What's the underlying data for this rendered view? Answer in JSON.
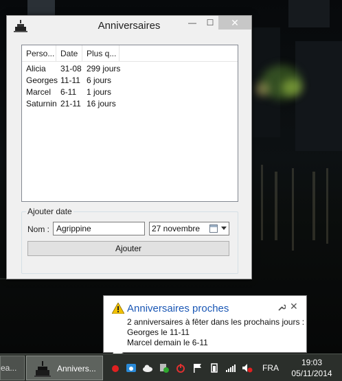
{
  "window": {
    "title": "Anniversaires",
    "controls": {
      "minimize": "—",
      "maximize": "☐",
      "close": "✕"
    }
  },
  "list": {
    "columns": [
      "Perso...",
      "Date",
      "Plus q..."
    ],
    "rows": [
      {
        "person": "Alicia",
        "date": "31-08",
        "remaining": "299 jours"
      },
      {
        "person": "Georges",
        "date": "11-11",
        "remaining": "6 jours"
      },
      {
        "person": "Marcel",
        "date": "6-11",
        "remaining": "1 jours"
      },
      {
        "person": "Saturnin",
        "date": "21-11",
        "remaining": "16 jours"
      }
    ]
  },
  "form": {
    "group_label": "Ajouter date",
    "name_label": "Nom :",
    "name_value": "Agrippine",
    "date_value": "27 novembre",
    "add_button": "Ajouter"
  },
  "notification": {
    "title": "Anniversaires proches",
    "close": "✕",
    "lines": [
      "2 anniversaires à fêter dans les prochains jours :",
      "Georges le 11-11",
      "Marcel demain le 6-11"
    ]
  },
  "taskbar": {
    "item1_label": "ea...",
    "item2_label": "Annivers...",
    "language": "FRA",
    "time": "19:03",
    "date": "05/11/2014"
  },
  "colors": {
    "notification_title": "#1a57b5",
    "close_button": "#c7c7c7",
    "taskbar": "#2b2f2b"
  }
}
